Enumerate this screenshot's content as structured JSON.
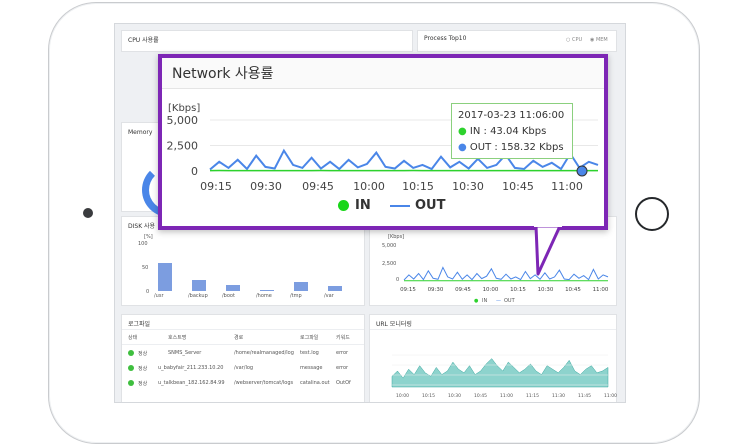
{
  "panels": {
    "cpu": "CPU 사용률",
    "process": "Process Top10",
    "process_toggle": [
      "CPU",
      "MEM"
    ],
    "memory": "Memory",
    "disk": "DISK 사용",
    "log": "로그파일",
    "url": "URL 모니터링"
  },
  "disk": {
    "unit": "[%]",
    "yticks": [
      "100",
      "50",
      "0"
    ],
    "categories": [
      "/usr",
      "/backup",
      "/boot",
      "/home",
      "/tmp",
      "/var"
    ],
    "values": [
      58,
      22,
      12,
      3,
      18,
      10
    ]
  },
  "small_network": {
    "unit": "[Kbps]",
    "yticks": [
      "5,000",
      "2,500",
      "0"
    ],
    "xticks": [
      "09:15",
      "09:30",
      "09:45",
      "10:00",
      "10:15",
      "10:30",
      "10:45",
      "11:00"
    ],
    "legend": [
      "IN",
      "OUT"
    ]
  },
  "log_table": {
    "headers": [
      "상태",
      "호스트명",
      "경로",
      "로그파일",
      "키워드"
    ],
    "rows": [
      [
        "정상",
        "SNMS_Server",
        "/home/realmanaged/log",
        "test.log",
        "error"
      ],
      [
        "정상",
        "u_babyfair_211.233.10.20",
        "/var/log",
        "message",
        "error"
      ],
      [
        "정상",
        "u_talkbean_182.162.84.99",
        "/webserver/tomcat/logs",
        "catalina.out",
        "OutOf"
      ]
    ]
  },
  "url_chart": {
    "xticks": [
      "10:00",
      "10:15",
      "10:30",
      "10:45",
      "11:00",
      "11:15",
      "11:30",
      "11:45",
      "11:00"
    ]
  },
  "popup": {
    "title": "Network 사용률",
    "tooltip": {
      "time": "2017-03-23 11:06:00",
      "in": "IN : 43.04 Kbps",
      "out": "OUT : 158.32 Kbps"
    },
    "legend_in": "IN",
    "legend_out": "OUT"
  },
  "colors": {
    "accent": "#7d26b5",
    "in": "#2dd22d",
    "out": "#4a86e8",
    "bar": "#7c9de0",
    "area": "#5cc0b8"
  },
  "chart_data": {
    "type": "line",
    "ylabel": "[Kbps]",
    "ylim": [
      0,
      5000
    ],
    "yticks": [
      "5,000",
      "2,500",
      "0"
    ],
    "xticks": [
      "09:15",
      "09:30",
      "09:45",
      "10:00",
      "10:15",
      "10:30",
      "10:45",
      "11:00"
    ],
    "series": [
      {
        "name": "IN",
        "values": [
          40,
          45,
          42,
          38,
          44,
          40,
          43,
          41,
          39,
          44,
          42,
          40,
          45,
          41,
          43,
          40,
          42,
          44,
          41,
          43,
          40,
          42,
          45,
          41,
          43,
          40,
          44,
          42,
          41,
          43,
          40,
          42,
          44,
          41,
          43,
          42,
          40,
          44,
          41,
          43,
          42,
          40,
          43
        ]
      },
      {
        "name": "OUT",
        "values": [
          150,
          900,
          300,
          1100,
          200,
          1500,
          400,
          250,
          2000,
          600,
          300,
          1300,
          250,
          900,
          200,
          1100,
          350,
          700,
          1800,
          400,
          250,
          1000,
          300,
          600,
          200,
          1400,
          350,
          900,
          250,
          1200,
          300,
          600,
          1600,
          300,
          200,
          1000,
          400,
          800,
          200,
          1700,
          300,
          900,
          600
        ]
      }
    ]
  }
}
